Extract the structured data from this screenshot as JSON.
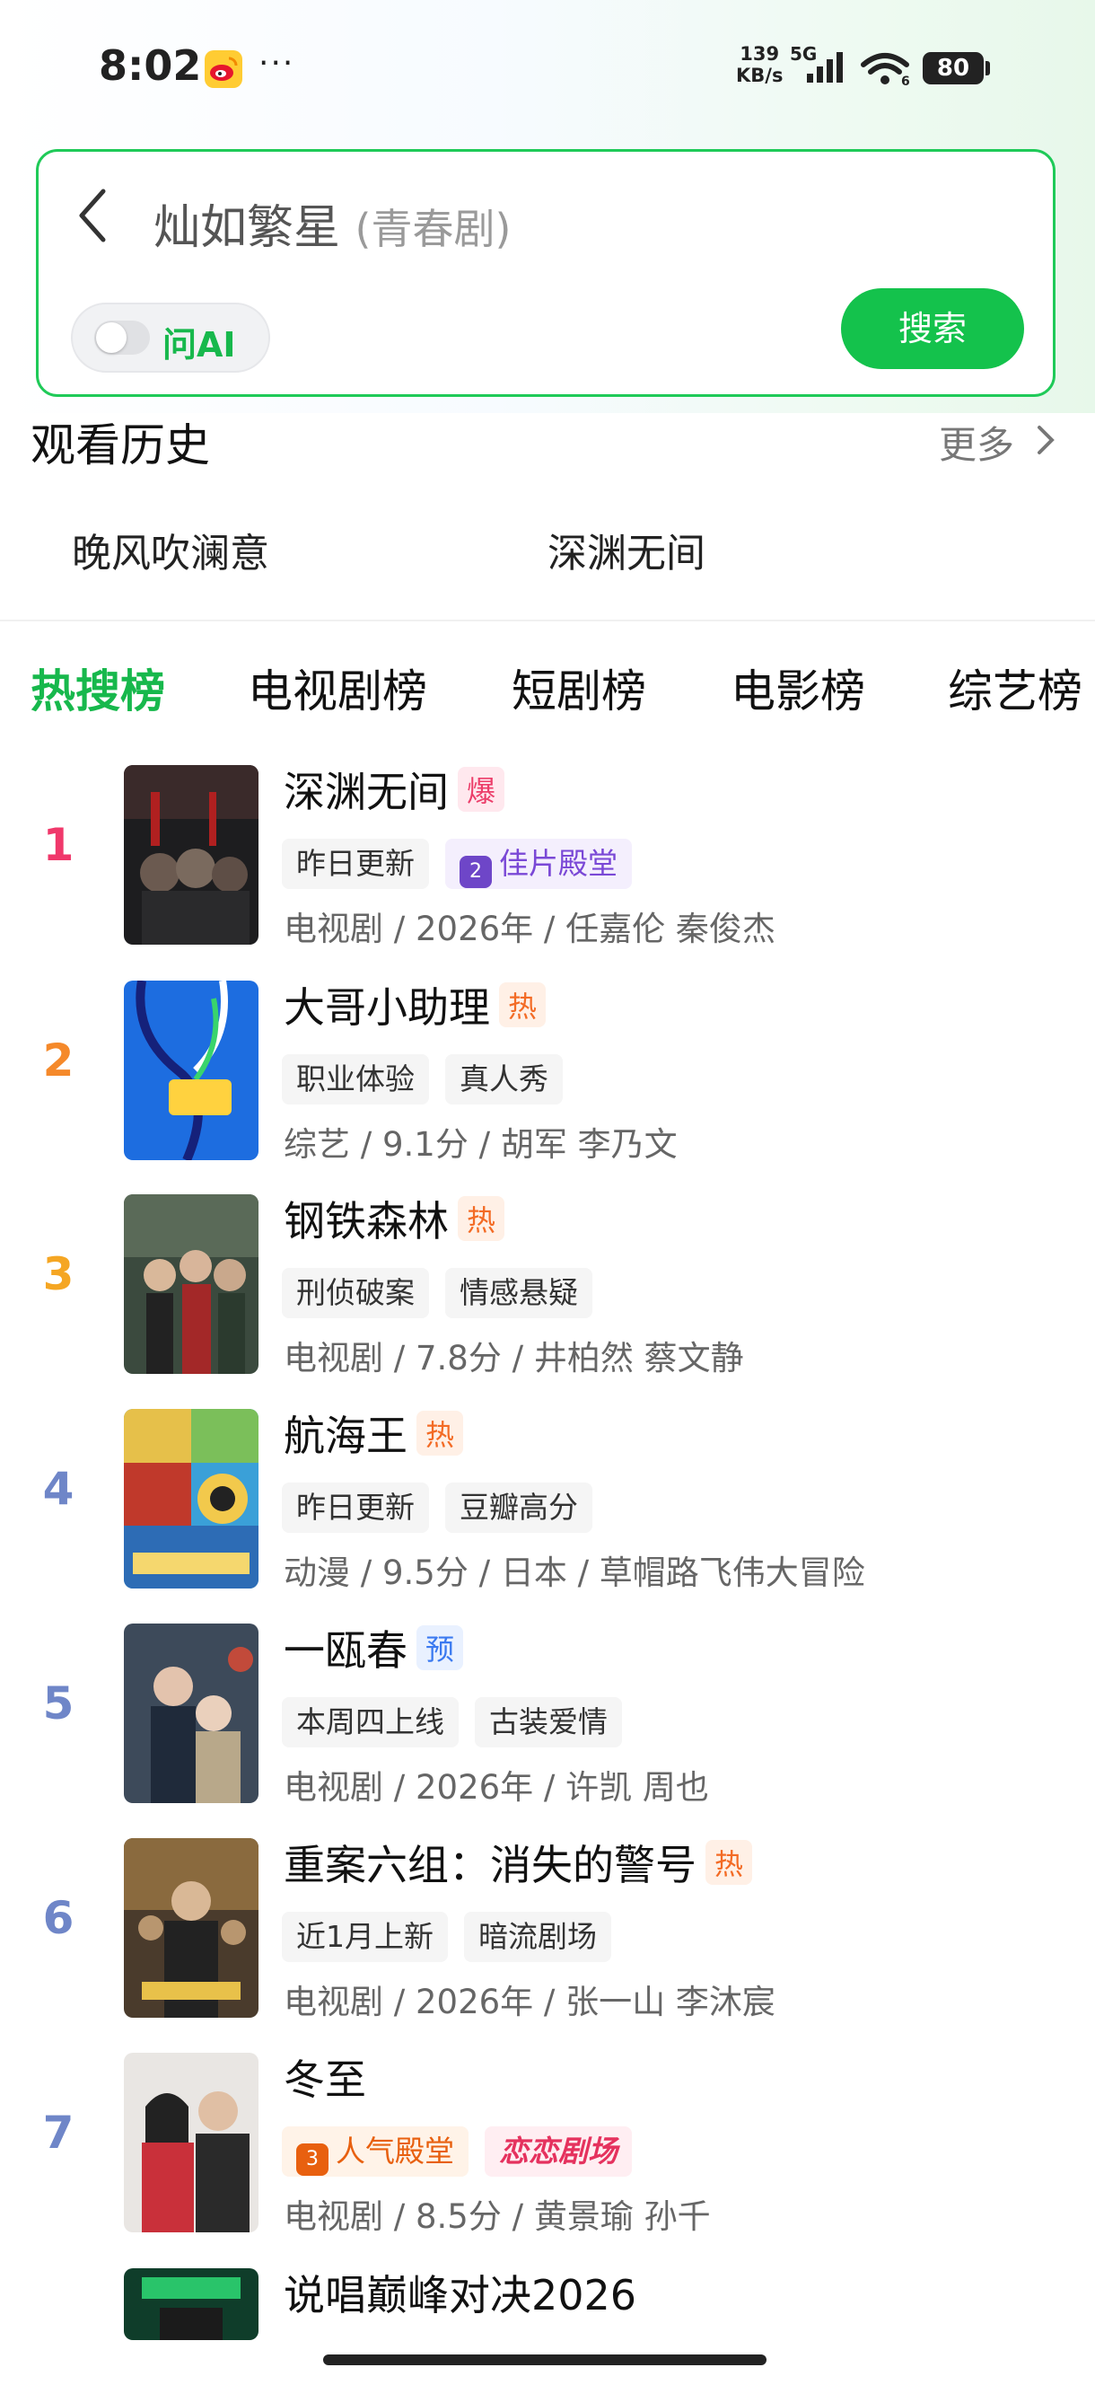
{
  "status_bar": {
    "time": "8:02",
    "net_speed_top": "139",
    "net_speed_bottom": "KB/s",
    "network": "5G",
    "battery": "80",
    "app_icon": "weibo-icon",
    "more": "···"
  },
  "search": {
    "query": "灿如繁星",
    "query_tag": "(青春剧)",
    "ai_label": "问AI",
    "ai_toggle_on": false,
    "search_button": "搜索",
    "accent": "#14c24c"
  },
  "history": {
    "title": "观看历史",
    "more": "更多",
    "items": [
      "晚风吹澜意",
      "深渊无间"
    ]
  },
  "tabs": [
    "热搜榜",
    "电视剧榜",
    "短剧榜",
    "电影榜",
    "综艺榜"
  ],
  "active_tab": 0,
  "ranking": [
    {
      "rank": "1",
      "title": "深渊无间",
      "badge": "爆",
      "tags": [
        "昨日更新",
        "佳片殿堂"
      ],
      "meta": "电视剧 / 2026年 / 任嘉伦 秦俊杰"
    },
    {
      "rank": "2",
      "title": "大哥小助理",
      "badge": "热",
      "tags": [
        "职业体验",
        "真人秀"
      ],
      "meta": "综艺 / 9.1分 / 胡军 李乃文"
    },
    {
      "rank": "3",
      "title": "钢铁森林",
      "badge": "热",
      "tags": [
        "刑侦破案",
        "情感悬疑"
      ],
      "meta": "电视剧 / 7.8分 / 井柏然 蔡文静"
    },
    {
      "rank": "4",
      "title": "航海王",
      "badge": "热",
      "tags": [
        "昨日更新",
        "豆瓣高分"
      ],
      "meta": "动漫 / 9.5分 / 日本 / 草帽路飞伟大冒险"
    },
    {
      "rank": "5",
      "title": "一瓯春",
      "badge": "预",
      "tags": [
        "本周四上线",
        "古装爱情"
      ],
      "meta": "电视剧 / 2026年 / 许凯 周也"
    },
    {
      "rank": "6",
      "title": "重案六组：消失的警号",
      "badge": "热",
      "tags": [
        "近1月上新",
        "暗流剧场"
      ],
      "meta": "电视剧 / 2026年 / 张一山 李沐宸"
    },
    {
      "rank": "7",
      "title": "冬至",
      "badge": "",
      "tags": [
        "人气殿堂",
        "恋恋剧场"
      ],
      "meta": "电视剧 / 8.5分 / 黄景瑜 孙千"
    },
    {
      "rank": "",
      "title": "说唱巅峰对决2026",
      "badge": "",
      "tags": [],
      "meta": ""
    }
  ],
  "rank_colors": {
    "1": "#f0386b",
    "2": "#f5892a",
    "3": "#f5a623",
    "other": "#6f86c8"
  }
}
